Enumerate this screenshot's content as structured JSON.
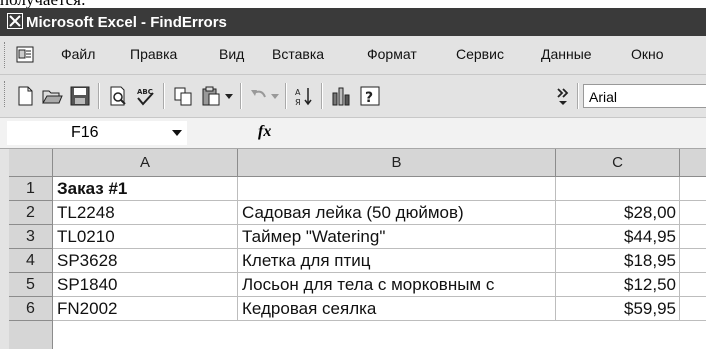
{
  "doc_text": "получается:",
  "window": {
    "title": "Microsoft Excel - FindErrors"
  },
  "menu": [
    "Файл",
    "Правка",
    "Вид",
    "Вставка",
    "Формат",
    "Сервис",
    "Данные",
    "Окно"
  ],
  "toolbar": {
    "font_name": "Arial",
    "icons": [
      "new-icon",
      "open-icon",
      "save-icon",
      "print-preview-icon",
      "spelling-icon",
      "copy-icon",
      "paste-icon",
      "undo-icon",
      "sort-icon",
      "chart-icon",
      "help-icon",
      "more-icon"
    ]
  },
  "formula_bar": {
    "name_box": "F16",
    "fx": "fx"
  },
  "columns": [
    "A",
    "B",
    "C"
  ],
  "rows": [
    {
      "num": "1",
      "a": "Заказ #1",
      "b": "",
      "c": ""
    },
    {
      "num": "2",
      "a": "TL2248",
      "b": "Садовая лейка (50 дюймов)",
      "c": "$28,00"
    },
    {
      "num": "3",
      "a": "TL0210",
      "b": "Таймер \"Watering\"",
      "c": "$44,95"
    },
    {
      "num": "4",
      "a": "SP3628",
      "b": "Клетка для птиц",
      "c": "$18,95"
    },
    {
      "num": "5",
      "a": "SP1840",
      "b": "Лосьон для тела с морковным с",
      "c": "$12,50"
    },
    {
      "num": "6",
      "a": "FN2002",
      "b": "Кедровая сеялка",
      "c": "$59,95"
    }
  ]
}
